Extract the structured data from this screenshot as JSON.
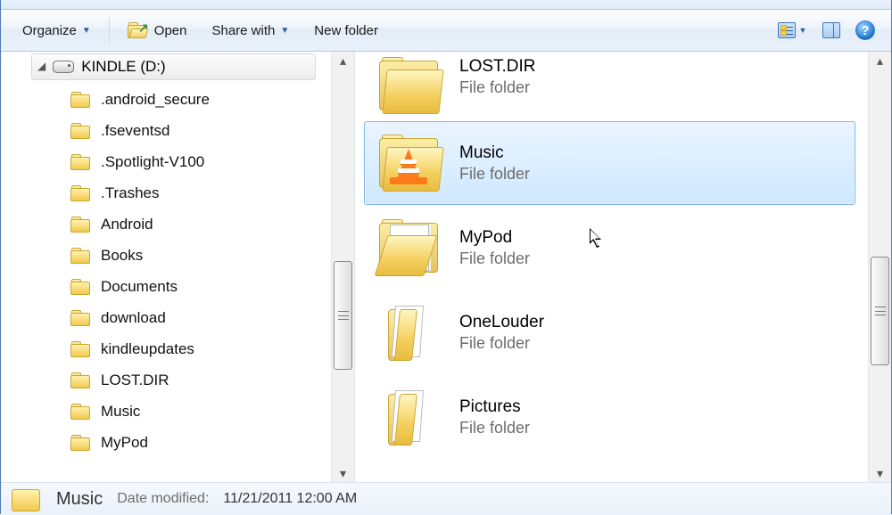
{
  "toolbar": {
    "organize": "Organize",
    "open": "Open",
    "share": "Share with",
    "newfolder": "New folder"
  },
  "tree": {
    "drive": "KINDLE (D:)",
    "items": [
      ".android_secure",
      ".fseventsd",
      ".Spotlight-V100",
      ".Trashes",
      "Android",
      "Books",
      "Documents",
      "download",
      "kindleupdates",
      "LOST.DIR",
      "Music",
      "MyPod"
    ]
  },
  "content": {
    "type_label": "File folder",
    "items": [
      {
        "name": "LOST.DIR",
        "icon": "closed",
        "selected": false
      },
      {
        "name": "Music",
        "icon": "vlc",
        "selected": true
      },
      {
        "name": "MyPod",
        "icon": "open",
        "selected": false
      },
      {
        "name": "OneLouder",
        "icon": "thin",
        "selected": false
      },
      {
        "name": "Pictures",
        "icon": "thin",
        "selected": false
      }
    ]
  },
  "details": {
    "name": "Music",
    "modified_label": "Date modified:",
    "modified_value": "11/21/2011 12:00 AM"
  }
}
